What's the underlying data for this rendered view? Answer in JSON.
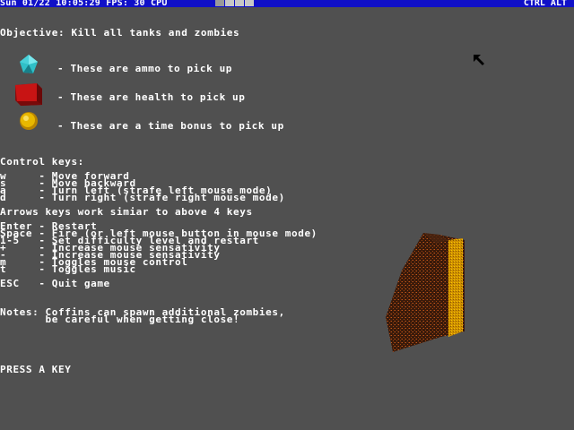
{
  "topbar": {
    "status": "Sun 01/22 10:05:29 FPS: 30 CPU",
    "keys": "CTRL ALT",
    "cpu_blocks": 5
  },
  "objective": "Objective: Kill all tanks and zombies",
  "pickups": [
    {
      "icon": "ammo-crystal-icon",
      "text": "- These are ammo to pick up"
    },
    {
      "icon": "health-cube-icon",
      "text": "- These are health to pick up"
    },
    {
      "icon": "time-bonus-orb-icon",
      "text": "- These are a time bonus to pick up"
    }
  ],
  "controls_title": "Control keys:",
  "controls": [
    "w     - Move forward",
    "s     - Move backward",
    "a     - Turn left (strafe left mouse mode)",
    "d     - Turn right (strafe right mouse mode)"
  ],
  "arrows_note": "Arrows keys work simiar to above 4 keys",
  "other_keys": [
    "Enter - Restart",
    "Space - Fire (or left mouse button in mouse mode)",
    "1-5   - Set difficulty level and restart",
    "+     - Increase mouse sensativity",
    "-     - Increase mouse sensativity",
    "m     - Toggles mouse control",
    "t     - Toggles music"
  ],
  "esc_key": "ESC   - Quit game",
  "notes": [
    "Notes: Coffins can spawn additional zombies,",
    "       be careful when getting close!"
  ],
  "prompt": "PRESS A KEY",
  "colors": {
    "background": "#505050",
    "topbar": "#1010c8",
    "text": "#ffffff",
    "ammo": "#30c0c8",
    "health": "#c01010",
    "time_bonus": "#e8b800",
    "coffin": "#5a2810"
  }
}
